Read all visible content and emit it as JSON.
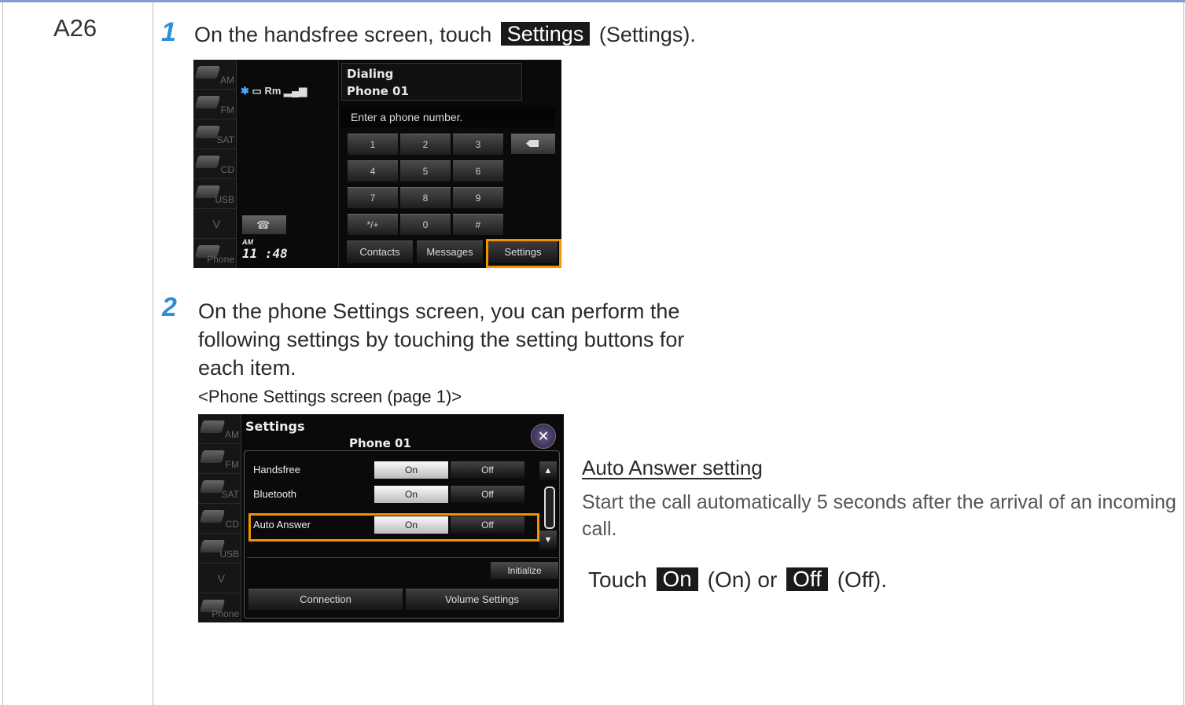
{
  "row_id": "A26",
  "step1": {
    "number": "1",
    "text_before": "On the handsfree screen, touch",
    "button_label": "Settings",
    "text_after": "(Settings)."
  },
  "screen1": {
    "side_items": [
      "AM",
      "FM",
      "SAT",
      "CD",
      "USB",
      "V",
      "Phone"
    ],
    "status": "Rm",
    "header_line1": "Dialing",
    "header_line2": "Phone 01",
    "field_placeholder": "Enter a phone number.",
    "keys": [
      "1",
      "2",
      "3",
      "4",
      "5",
      "6",
      "7",
      "8",
      "9",
      "*/+",
      "0",
      "#"
    ],
    "clock_ampm": "AM",
    "clock_time": "11 :48",
    "bottom_buttons": [
      "Contacts",
      "Messages",
      "Settings"
    ],
    "highlight_color": "#f39200"
  },
  "step2": {
    "number": "2",
    "text": "On the phone Settings screen, you can perform the following settings by touching the setting buttons for each item.",
    "caption": "<Phone Settings screen (page 1)>"
  },
  "screen2": {
    "title": "Settings",
    "subtitle": "Phone 01",
    "close_glyph": "✕",
    "rows": [
      {
        "label": "Handsfree",
        "on": "On",
        "off": "Off"
      },
      {
        "label": "Bluetooth",
        "on": "On",
        "off": "Off"
      },
      {
        "label": "Auto Answer",
        "on": "On",
        "off": "Off"
      }
    ],
    "initialize": "Initialize",
    "bottom_buttons": [
      "Connection",
      "Volume Settings"
    ]
  },
  "auto_answer": {
    "title": "Auto Answer setting",
    "description": "Start the call automatically 5 seconds after the arrival of an incoming call.",
    "touch_prefix": "Touch",
    "on_label": "On",
    "on_paren": "(On) or",
    "off_label": "Off",
    "off_paren": "(Off)."
  }
}
